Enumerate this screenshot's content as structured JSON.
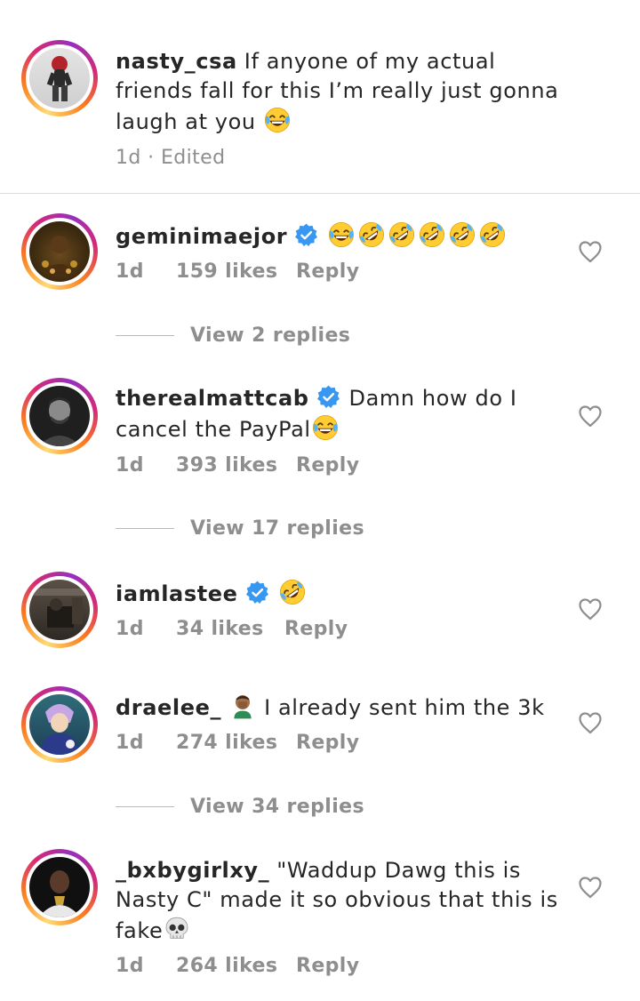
{
  "caption": {
    "username": "nasty_csa",
    "text": "If anyone of my actual friends fall for this I’m really just gonna laugh at you",
    "emoji": "face-with-tears-of-joy",
    "meta": "1d · Edited"
  },
  "comments": [
    {
      "username": "geminimaejor",
      "verified": true,
      "text": "",
      "emojis": [
        "face-with-tears-of-joy",
        "rolling-on-floor-laughing",
        "rolling-on-floor-laughing",
        "rolling-on-floor-laughing",
        "rolling-on-floor-laughing",
        "rolling-on-floor-laughing"
      ],
      "time": "1d",
      "likes": "159 likes",
      "reply": "Reply",
      "view_replies": "View 2 replies"
    },
    {
      "username": "therealmattcab",
      "verified": true,
      "text": "Damn how do I cancel the PayPal",
      "emojis": [
        "face-with-tears-of-joy"
      ],
      "time": "1d",
      "likes": "393 likes",
      "reply": "Reply",
      "view_replies": "View 17 replies"
    },
    {
      "username": "iamlastee",
      "verified": true,
      "text": "",
      "emojis": [
        "rolling-on-floor-laughing"
      ],
      "time": "1d",
      "likes": "34 likes",
      "reply": "Reply"
    },
    {
      "username": "draelee_",
      "verified": false,
      "text": "I already sent him the 3k",
      "emojis_before": [
        "person-facepalming"
      ],
      "time": "1d",
      "likes": "274 likes",
      "reply": "Reply",
      "view_replies": "View 34 replies"
    },
    {
      "username": "_bxbygirlxy_",
      "verified": false,
      "text": "\"Waddup Dawg this is Nasty C\" made it so obvious that this is fake",
      "emojis": [
        "skull"
      ],
      "time": "1d",
      "likes": "264 likes",
      "reply": "Reply"
    }
  ],
  "colors": {
    "text": "#262626",
    "secondary": "#8e8e8e",
    "verified_blue": "#3897f0",
    "divider": "#dbdbdb"
  }
}
